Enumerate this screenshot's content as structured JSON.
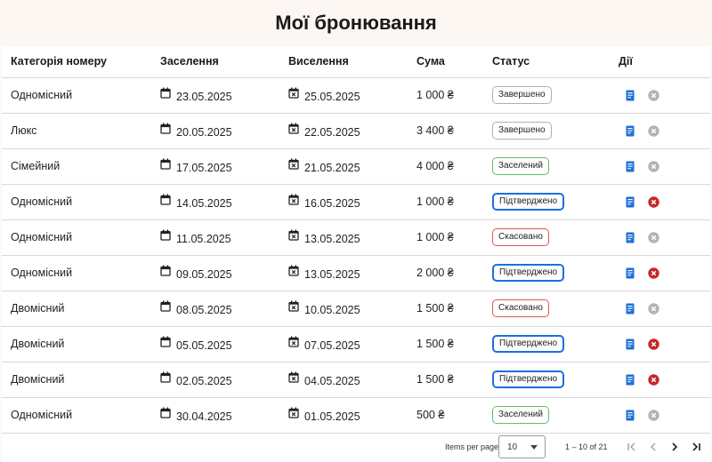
{
  "page": {
    "title": "Мої бронювання"
  },
  "table": {
    "headers": {
      "category": "Категорія номеру",
      "checkin": "Заселення",
      "checkout": "Виселення",
      "sum": "Сума",
      "status": "Статус",
      "actions": "Дії"
    },
    "rows": [
      {
        "category": "Одномісний",
        "checkin": "23.05.2025",
        "checkout": "25.05.2025",
        "sum": "1 000 ₴",
        "status": "Завершено",
        "status_type": "completed",
        "cancel_enabled": false
      },
      {
        "category": "Люкс",
        "checkin": "20.05.2025",
        "checkout": "22.05.2025",
        "sum": "3 400 ₴",
        "status": "Завершено",
        "status_type": "completed",
        "cancel_enabled": false
      },
      {
        "category": "Сімейний",
        "checkin": "17.05.2025",
        "checkout": "21.05.2025",
        "sum": "4 000 ₴",
        "status": "Заселений",
        "status_type": "settled",
        "cancel_enabled": false
      },
      {
        "category": "Одномісний",
        "checkin": "14.05.2025",
        "checkout": "16.05.2025",
        "sum": "1 000 ₴",
        "status": "Підтверджено",
        "status_type": "confirmed",
        "cancel_enabled": true
      },
      {
        "category": "Одномісний",
        "checkin": "11.05.2025",
        "checkout": "13.05.2025",
        "sum": "1 000 ₴",
        "status": "Скасовано",
        "status_type": "cancelled",
        "cancel_enabled": false
      },
      {
        "category": "Одномісний",
        "checkin": "09.05.2025",
        "checkout": "13.05.2025",
        "sum": "2 000 ₴",
        "status": "Підтверджено",
        "status_type": "confirmed",
        "cancel_enabled": true
      },
      {
        "category": "Двомісний",
        "checkin": "08.05.2025",
        "checkout": "10.05.2025",
        "sum": "1 500 ₴",
        "status": "Скасовано",
        "status_type": "cancelled",
        "cancel_enabled": false
      },
      {
        "category": "Двомісний",
        "checkin": "05.05.2025",
        "checkout": "07.05.2025",
        "sum": "1 500 ₴",
        "status": "Підтверджено",
        "status_type": "confirmed",
        "cancel_enabled": true
      },
      {
        "category": "Двомісний",
        "checkin": "02.05.2025",
        "checkout": "04.05.2025",
        "sum": "1 500 ₴",
        "status": "Підтверджено",
        "status_type": "confirmed",
        "cancel_enabled": true
      },
      {
        "category": "Одномісний",
        "checkin": "30.04.2025",
        "checkout": "01.05.2025",
        "sum": "500 ₴",
        "status": "Заселений",
        "status_type": "settled",
        "cancel_enabled": false
      }
    ]
  },
  "paginator": {
    "items_per_page_label": "Items per page:",
    "page_size": "10",
    "range_label": "1 – 10 of 21"
  },
  "icons": {
    "checkin": "calendar-icon",
    "checkout": "calendar-x-icon",
    "details": "receipt-icon",
    "cancel": "cancel-circle-icon"
  },
  "colors": {
    "accent_blue": "#1e6fd9",
    "cancel_red": "#c62828",
    "disabled_gray": "#b3b3b3",
    "settled_green": "#5cbf6a",
    "cancelled_red": "#e05555"
  }
}
